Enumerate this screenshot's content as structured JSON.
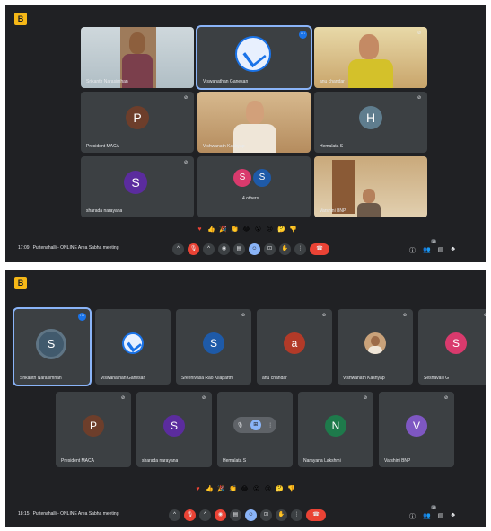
{
  "logo_label": "B",
  "top": {
    "tiles": [
      {
        "name": "Srikanth Narasimhan"
      },
      {
        "name": "Viswanathan Ganesan"
      },
      {
        "name": "anu chandar"
      },
      {
        "name": "President MACA",
        "initial": "P"
      },
      {
        "name": "Vishwanath Kashyap"
      },
      {
        "name": "Hemalata S",
        "initial": "H"
      },
      {
        "name": "sharada narayana",
        "initial": "S"
      },
      {
        "name": "4 others",
        "initials": [
          "S",
          "S"
        ]
      },
      {
        "name": "Varshini BNP"
      }
    ],
    "reactions": [
      "♥",
      "👍",
      "🎉",
      "👏",
      "😂",
      "😮",
      "😢",
      "🤔",
      "👎"
    ],
    "meeting": "17:09  |  Puttenahalli - ONLINE Area Sabha meeting",
    "participants_count": "13"
  },
  "bottom": {
    "tiles_row1": [
      {
        "name": "Srikanth Narasimhan",
        "initial": "S"
      },
      {
        "name": "Viswanathan Ganesan"
      },
      {
        "name": "Sreenivasa Rao Kilaparthi",
        "initial": "S"
      },
      {
        "name": "anu chandar",
        "initial": "a"
      },
      {
        "name": "Vishwanath Kashyap"
      },
      {
        "name": "Seshavalli G",
        "initial": "S"
      }
    ],
    "tiles_row2": [
      {
        "name": "President MACA",
        "initial": "P"
      },
      {
        "name": "sharada narayana",
        "initial": "S"
      },
      {
        "name": "Hemalata S"
      },
      {
        "name": "Narayana Lakshmi",
        "initial": "N"
      },
      {
        "name": "Varshini BNP",
        "initial": "V"
      }
    ],
    "reactions": [
      "♥",
      "👍",
      "🎉",
      "👏",
      "😂",
      "😮",
      "😢",
      "🤔",
      "👎"
    ],
    "meeting": "18:15  |  Puttenahalli - ONLINE Area Sabha meeting",
    "participants_count": "13"
  },
  "controls": {
    "caret": "^",
    "mic": "🎙",
    "camera": "◉",
    "captions": "▤",
    "emoji": "☺",
    "present": "⊡",
    "hand": "✋",
    "more": "⋮",
    "hangup": "☎"
  },
  "right_icons": {
    "info": "ⓘ",
    "people": "👥",
    "chat": "▤",
    "activities": "♣"
  },
  "colors": {
    "panel_bg": "#202124",
    "tile_bg": "#3c4043",
    "accent": "#8ab4f8",
    "red": "#ea4335",
    "logo": "#f6b817"
  }
}
